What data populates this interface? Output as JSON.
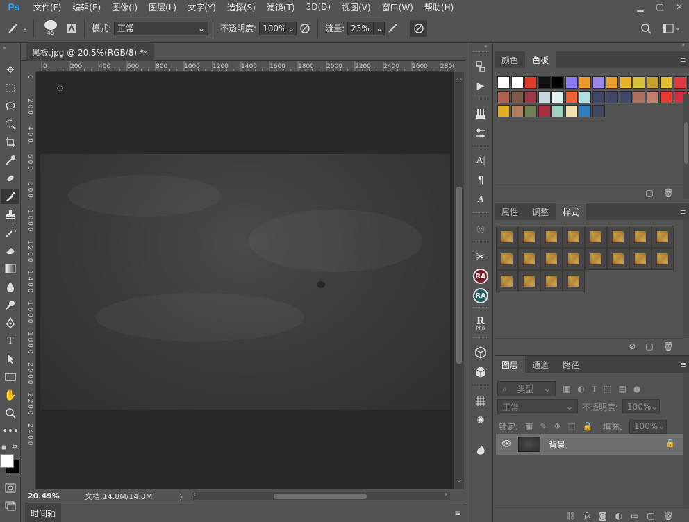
{
  "app": {
    "logo": "Ps",
    "menu": [
      "文件(F)",
      "编辑(E)",
      "图像(I)",
      "图层(L)",
      "文字(Y)",
      "选择(S)",
      "滤镜(T)",
      "3D(D)",
      "视图(V)",
      "窗口(W)",
      "帮助(H)"
    ]
  },
  "options": {
    "brush_size": "45",
    "mode_label": "模式:",
    "mode_value": "正常",
    "opacity_label": "不透明度:",
    "opacity_value": "100%",
    "flow_label": "流量:",
    "flow_value": "23%"
  },
  "document": {
    "tab_title": "黑板.jpg @ 20.5%(RGB/8) *",
    "close_glyph": "×",
    "ruler_top_ticks": [
      "0",
      "200",
      "400",
      "600",
      "800",
      "1000",
      "1200",
      "1400",
      "1600",
      "1800",
      "2000",
      "2200",
      "2400",
      "2600",
      "2800"
    ],
    "ruler_left_ticks": [
      "0",
      "2 0 0",
      "4 0 0",
      "6 0 0",
      "8 0 0",
      "1 0 0 0",
      "1 2 0 0",
      "1 4 0 0",
      "1 6 0 0",
      "1 8 0 0",
      "2 0 0 0",
      "2 2 0 0",
      "2 4 0 0"
    ],
    "zoom": "20.49%",
    "doc_info": "文档:14.8M/14.8M"
  },
  "timeline": {
    "tab_label": "时间轴"
  },
  "swatches_panel": {
    "tabs": [
      "颜色",
      "色板"
    ],
    "active_tab": "色板",
    "colors": [
      "#ffffff",
      "#ffffff",
      "#e03a2a",
      "#111111",
      "#000000",
      "#8a7cf0",
      "#ee9b2b",
      "#9b86e8",
      "#e8a02b",
      "#e8b02b",
      "#d9c23b",
      "#c8a030",
      "#e0c030",
      "#e03a40",
      "#444444",
      "#b06050",
      "#7a5a4a",
      "#9a3a4a",
      "#c8d8e0",
      "#e0f0f0",
      "#f06030",
      "#b0e0e0",
      "#404868",
      "#404868",
      "#404868",
      "#b07060",
      "#c08070",
      "#e83a30",
      "#d03040",
      "#e09020",
      "#e0b020",
      "#b08060",
      "#708050",
      "#a83040",
      "#a0d0c0",
      "#f0e0b0",
      "#3080c0",
      "#404860"
    ]
  },
  "styles_panel": {
    "tabs": [
      "属性",
      "调整",
      "样式"
    ],
    "active_tab": "样式",
    "count": 20
  },
  "layers_panel": {
    "tabs": [
      "图层",
      "通道",
      "路径"
    ],
    "active_tab": "图层",
    "filter_placeholder": "类型",
    "blend_mode": "正常",
    "opacity_label": "不透明度:",
    "opacity_value": "100%",
    "lock_label": "锁定:",
    "fill_label": "填充:",
    "fill_value": "100%",
    "layers": [
      {
        "name": "背景",
        "visible": true,
        "locked": true
      }
    ],
    "footer_fx": "fx"
  },
  "icon_strip": {
    "ra1": "RA",
    "ra2": "RA",
    "rpro": "R",
    "rpro_sub": "PRO"
  }
}
